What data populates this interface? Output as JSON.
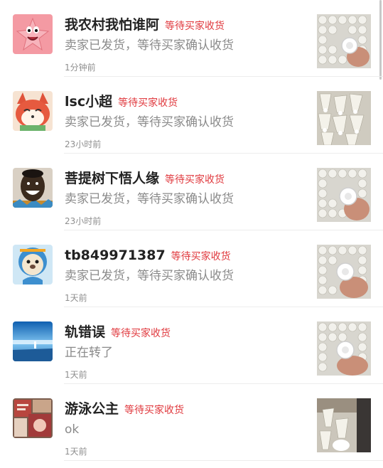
{
  "conversations": [
    {
      "name": "我农村我怕谁阿",
      "status": "等待买家收货",
      "message": "卖家已发货，等待买家确认收货",
      "time": "1分钟前",
      "avatar_icon": "patrick-star-avatar-icon",
      "thumb_icon": "badminton-shuttlecock-product-icon"
    },
    {
      "name": "lsc小超",
      "status": "等待买家收货",
      "message": "卖家已发货，等待买家确认收货",
      "time": "23小时前",
      "avatar_icon": "cartoon-fox-avatar-icon",
      "thumb_icon": "badminton-shuttlecock-product-icon"
    },
    {
      "name": "菩提树下悟人缘",
      "status": "等待买家收货",
      "message": "卖家已发货，等待买家确认收货",
      "time": "23小时前",
      "avatar_icon": "smiling-man-avatar-icon",
      "thumb_icon": "badminton-shuttlecock-product-icon"
    },
    {
      "name": "tb849971387",
      "status": "等待买家收货",
      "message": "卖家已发货，等待买家确认收货",
      "time": "1天前",
      "avatar_icon": "blue-seal-avatar-icon",
      "thumb_icon": "badminton-shuttlecock-product-icon"
    },
    {
      "name": "轨错误",
      "status": "等待买家收货",
      "message": "正在转了",
      "time": "1天前",
      "avatar_icon": "sky-landscape-avatar-icon",
      "thumb_icon": "badminton-shuttlecock-product-icon"
    },
    {
      "name": "游泳公主",
      "status": "等待买家收货",
      "message": "ok",
      "time": "1天前",
      "avatar_icon": "collage-photo-avatar-icon",
      "thumb_icon": "badminton-shuttlecock-product-icon"
    }
  ],
  "colors": {
    "status_red": "#e0393e",
    "name_text": "#222222",
    "message_text": "#8a8a8a",
    "time_text": "#8f8f8f"
  }
}
